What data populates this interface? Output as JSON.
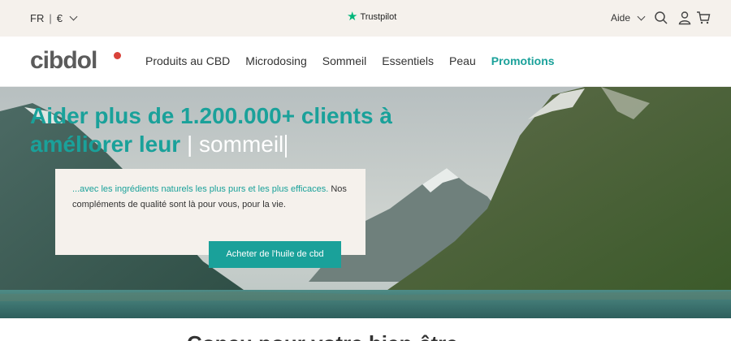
{
  "topbar": {
    "language": "FR",
    "currency": "€",
    "trustpilot": "Trustpilot",
    "help": "Aide"
  },
  "icons": {
    "search": "search-icon",
    "account": "user-icon",
    "cart": "cart-icon",
    "star": "trustpilot-star-icon"
  },
  "nav": {
    "logo": "cibdol",
    "items": [
      "Produits au CBD",
      "Microdosing",
      "Sommeil",
      "Essentiels",
      "Peau",
      "Promotions"
    ]
  },
  "hero": {
    "headline_line1": "Aider plus de 1.200.000+ clients à",
    "headline_line2": "améliorer leur",
    "typed_word": "sommeil",
    "card_highlight": "...avec les ingrédients naturels les plus purs et les plus efficaces.",
    "card_text": " Nos compléments de qualité sont là pour vous, pour la vie.",
    "cta": "Acheter de l'huile de cbd"
  },
  "section": {
    "title": "Conçu pour votre bien-être"
  },
  "colors": {
    "brand": "#1aa19a",
    "topbar_bg": "#f5f1ec",
    "trustpilot": "#00b67a",
    "logo_badge": "#d9423a"
  }
}
